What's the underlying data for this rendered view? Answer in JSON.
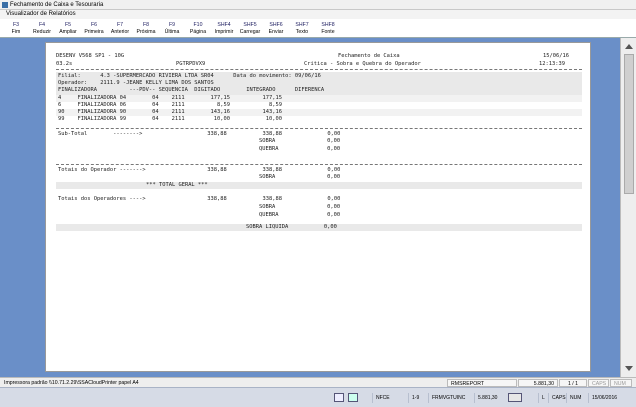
{
  "window": {
    "title": "Fechamento de Caixa e Tesouraria",
    "subtitle": "Visualizador de Relatórios"
  },
  "toolbar": [
    {
      "key": "F3",
      "label": "Fim"
    },
    {
      "key": "F4",
      "label": "Reduzir"
    },
    {
      "key": "F5",
      "label": "Ampliar"
    },
    {
      "key": "F6",
      "label": "Primeira"
    },
    {
      "key": "F7",
      "label": "Anterior"
    },
    {
      "key": "F8",
      "label": "Próxima"
    },
    {
      "key": "F9",
      "label": "Última"
    },
    {
      "key": "F10",
      "label": "Página"
    },
    {
      "key": "SHF4",
      "label": "Imprimir"
    },
    {
      "key": "SHF5",
      "label": "Carregar"
    },
    {
      "key": "SHF6",
      "label": "Enviar"
    },
    {
      "key": "SHF7",
      "label": "Texto"
    },
    {
      "key": "SHF8",
      "label": "Fonte"
    }
  ],
  "report": {
    "header_left_1": "DESENV V568 SP1 - 10G",
    "header_left_2": "03.2s",
    "header_center_1": "PGTRPDVX9",
    "header_right_title": "Fechamento de Caixa",
    "header_right_sub": "Critica - Sobra e Quebra do Operador",
    "date": "15/06/16",
    "time": "12:13:39",
    "filial_line": "Filial:      4.3 -SUPERMERCADO RIVIERA LTDA SR04      Data do movimento: 09/06/16",
    "operador_line": "Operador:    2111.9 -JEANE KELLY LIMA DOS SANTOS",
    "columns_line": "FINALIZADORA          ---PDV-- SEQUENCIA  DIGITADO        INTEGRADO      DIFERENCA",
    "rows": [
      "4     FINALIZADORA 04        04    2111        177,15          177,15",
      "6     FINALIZADORA 06        04    2111          8,59            8,59",
      "90    FINALIZADORA 90        04    2111        143,16          143,16",
      "99    FINALIZADORA 99        04    2111         10,00           10,00"
    ],
    "subtotal_line": "Sub-Total        -------->                    338,88           338,88              0,00",
    "subtotal_sobra": "SOBRA                0,00",
    "subtotal_quebra": "QUEBRA               0,00",
    "totop_line": "Totais do Operador ------->                   338,88           338,88              0,00",
    "totop_sobra": "SOBRA                0,00",
    "total_geral": "*** TOTAL GERAL ***",
    "totops_line": "Totais dos Operadores ---->                   338,88           338,88              0,00",
    "totops_sobra": "SOBRA                0,00",
    "totops_quebra": "QUEBRA               0,00",
    "sobra_liquida": "SOBRA LIQUIDA           0,00"
  },
  "statusbar": {
    "printer": "Impressora padrão \\\\10.71.2.29\\SSACloudPrinter papel A4",
    "report_name": "RMSREPORT",
    "value": "5.881,30",
    "pages": "1 / 1",
    "caps": "CAPS",
    "num": "NUM"
  },
  "taskbar": {
    "app": "NFCE",
    "range": "1-9",
    "module": "FRMVGTUINC",
    "value": "5.881,30",
    "l": "L",
    "caps": "CAPS",
    "num": "NUM",
    "date": "15/06/2016"
  }
}
